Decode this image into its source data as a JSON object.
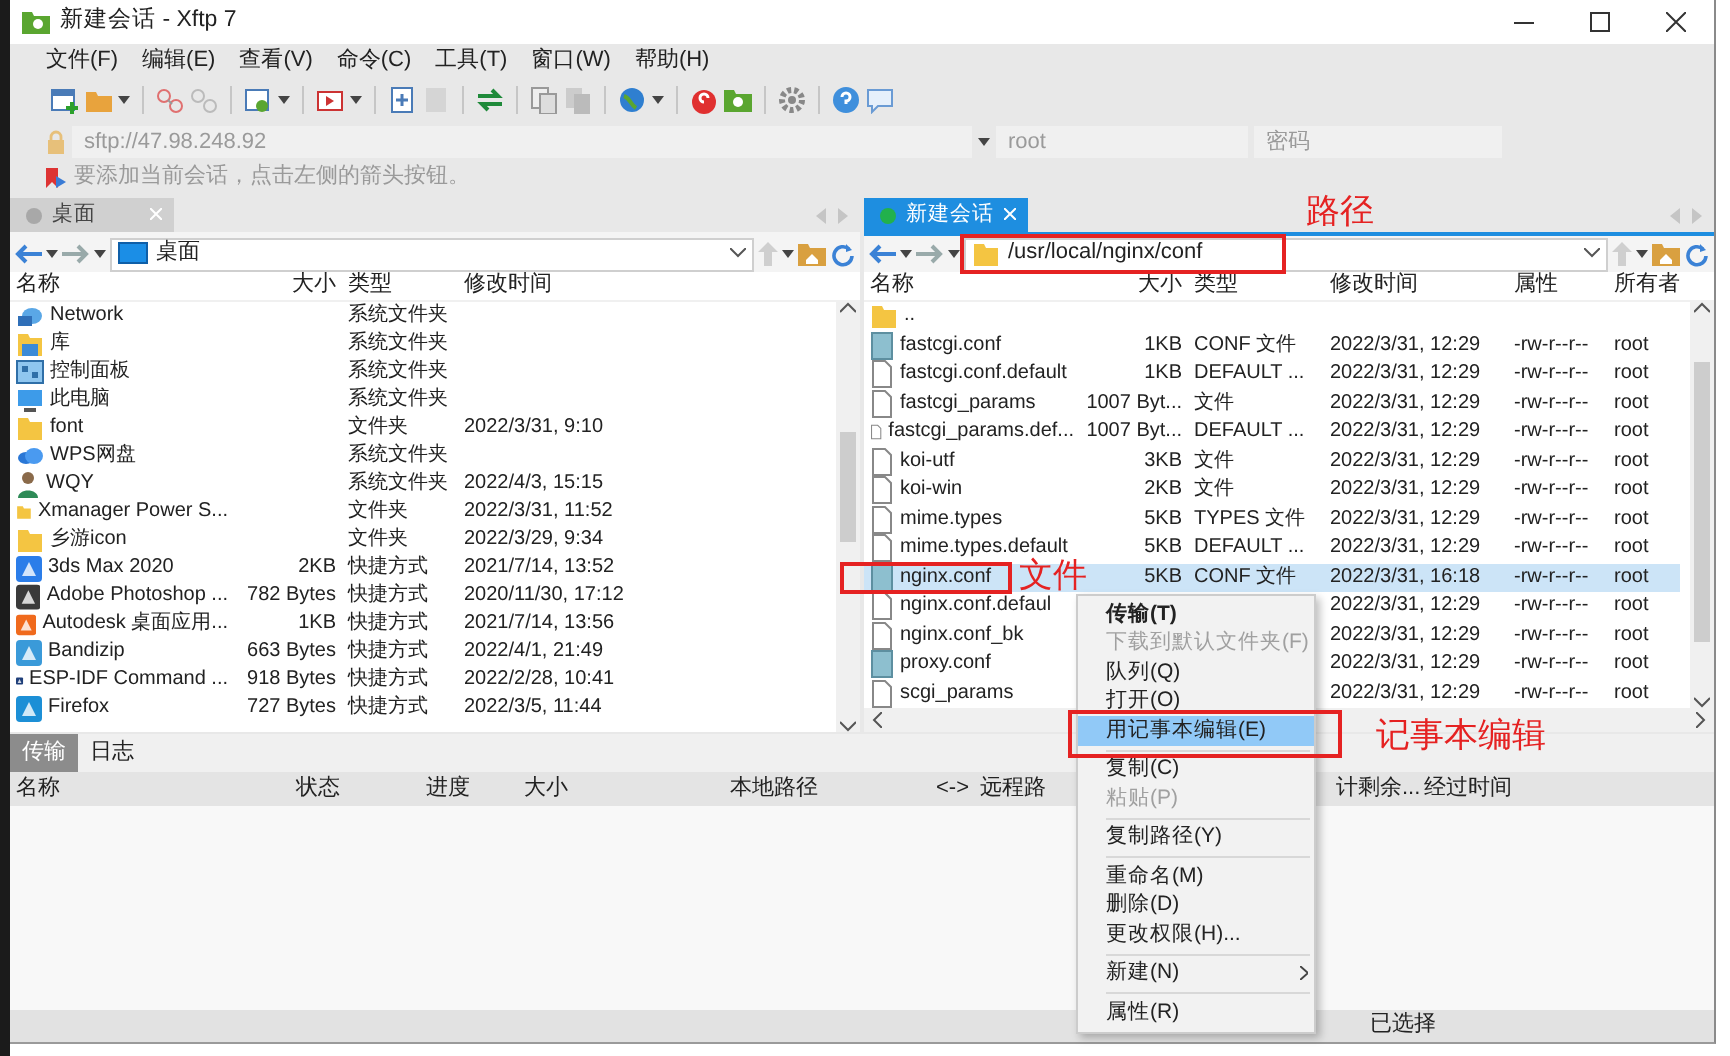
{
  "window": {
    "title": "新建会话 - Xftp 7"
  },
  "menu": [
    "文件(F)",
    "编辑(E)",
    "查看(V)",
    "命令(C)",
    "工具(T)",
    "窗口(W)",
    "帮助(H)"
  ],
  "address": {
    "host": "sftp://47.98.248.92",
    "user": "root",
    "password_placeholder": "密码"
  },
  "hint": "要添加当前会话，点击左侧的箭头按钮。",
  "panes": [
    {
      "tab": {
        "label": "桌面",
        "selected": false,
        "color": "#a8a8a8"
      },
      "path": "桌面",
      "columns": [
        "名称",
        "大小",
        "类型",
        "修改时间"
      ],
      "rows": [
        {
          "name": "Network",
          "type": "系统文件夹",
          "kind": "network",
          "selected": false
        },
        {
          "name": "库",
          "type": "系统文件夹",
          "kind": "library",
          "selected": false
        },
        {
          "name": "控制面板",
          "type": "系统文件夹",
          "kind": "panel",
          "selected": false
        },
        {
          "name": "此电脑",
          "type": "系统文件夹",
          "kind": "computer",
          "selected": false
        },
        {
          "name": "font",
          "type": "文件夹",
          "date": "2022/3/31, 9:10",
          "kind": "folder",
          "selected": false
        },
        {
          "name": "WPS网盘",
          "type": "系统文件夹",
          "kind": "cloud",
          "selected": false
        },
        {
          "name": "WQY",
          "type": "系统文件夹",
          "date": "2022/4/3, 15:15",
          "kind": "user",
          "selected": false
        },
        {
          "name": "Xmanager Power S...",
          "type": "文件夹",
          "date": "2022/3/31, 11:52",
          "kind": "folder",
          "selected": false
        },
        {
          "name": "乡游icon",
          "type": "文件夹",
          "date": "2022/3/29, 9:34",
          "kind": "folder",
          "selected": false
        },
        {
          "name": "3ds Max 2020",
          "size": "2KB",
          "type": "快捷方式",
          "date": "2021/7/14, 13:52",
          "kind": "app",
          "selected": false
        },
        {
          "name": "Adobe Photoshop ...",
          "size": "782 Bytes",
          "type": "快捷方式",
          "date": "2020/11/30, 17:12",
          "kind": "app",
          "selected": false
        },
        {
          "name": "Autodesk 桌面应用...",
          "size": "1KB",
          "type": "快捷方式",
          "date": "2021/7/14, 13:56",
          "kind": "app",
          "selected": false
        },
        {
          "name": "Bandizip",
          "size": "663 Bytes",
          "type": "快捷方式",
          "date": "2022/4/1, 21:49",
          "kind": "app",
          "selected": false
        },
        {
          "name": "ESP-IDF Command ...",
          "size": "918 Bytes",
          "type": "快捷方式",
          "date": "2022/2/28, 10:41",
          "kind": "app",
          "selected": false
        },
        {
          "name": "Firefox",
          "size": "727 Bytes",
          "type": "快捷方式",
          "date": "2022/3/5, 11:44",
          "kind": "app",
          "selected": false
        }
      ]
    },
    {
      "tab": {
        "label": "新建会话",
        "selected": true,
        "color": "#22b14c"
      },
      "path": "/usr/local/nginx/conf",
      "columns": [
        "名称",
        "大小",
        "类型",
        "修改时间",
        "属性",
        "所有者"
      ],
      "rows": [
        {
          "name": "..",
          "kind": "folder",
          "selected": false
        },
        {
          "name": "fastcgi.conf",
          "size": "1KB",
          "type": "CONF 文件",
          "date": "2022/3/31, 12:29",
          "perm": "-rw-r--r--",
          "owner": "root",
          "kind": "conf",
          "selected": false
        },
        {
          "name": "fastcgi.conf.default",
          "size": "1KB",
          "type": "DEFAULT ...",
          "date": "2022/3/31, 12:29",
          "perm": "-rw-r--r--",
          "owner": "root",
          "kind": "file",
          "selected": false
        },
        {
          "name": "fastcgi_params",
          "size": "1007 Byt...",
          "type": "文件",
          "date": "2022/3/31, 12:29",
          "perm": "-rw-r--r--",
          "owner": "root",
          "kind": "file",
          "selected": false
        },
        {
          "name": "fastcgi_params.def...",
          "size": "1007 Byt...",
          "type": "DEFAULT ...",
          "date": "2022/3/31, 12:29",
          "perm": "-rw-r--r--",
          "owner": "root",
          "kind": "file",
          "selected": false
        },
        {
          "name": "koi-utf",
          "size": "3KB",
          "type": "文件",
          "date": "2022/3/31, 12:29",
          "perm": "-rw-r--r--",
          "owner": "root",
          "kind": "file",
          "selected": false
        },
        {
          "name": "koi-win",
          "size": "2KB",
          "type": "文件",
          "date": "2022/3/31, 12:29",
          "perm": "-rw-r--r--",
          "owner": "root",
          "kind": "file",
          "selected": false
        },
        {
          "name": "mime.types",
          "size": "5KB",
          "type": "TYPES 文件",
          "date": "2022/3/31, 12:29",
          "perm": "-rw-r--r--",
          "owner": "root",
          "kind": "file",
          "selected": false
        },
        {
          "name": "mime.types.default",
          "size": "5KB",
          "type": "DEFAULT ...",
          "date": "2022/3/31, 12:29",
          "perm": "-rw-r--r--",
          "owner": "root",
          "kind": "file",
          "selected": false
        },
        {
          "name": "nginx.conf",
          "size": "5KB",
          "type": "CONF 文件",
          "date": "2022/3/31, 16:18",
          "perm": "-rw-r--r--",
          "owner": "root",
          "kind": "conf",
          "selected": true
        },
        {
          "name": "nginx.conf.defaul",
          "date": "2022/3/31, 12:29",
          "perm": "-rw-r--r--",
          "owner": "root",
          "kind": "file",
          "selected": false
        },
        {
          "name": "nginx.conf_bk",
          "date": "2022/3/31, 12:29",
          "perm": "-rw-r--r--",
          "owner": "root",
          "kind": "file",
          "selected": false
        },
        {
          "name": "proxy.conf",
          "date": "2022/3/31, 12:29",
          "perm": "-rw-r--r--",
          "owner": "root",
          "kind": "conf",
          "selected": false
        },
        {
          "name": "scgi_params",
          "date": "2022/3/31, 12:29",
          "perm": "-rw-r--r--",
          "owner": "root",
          "kind": "file",
          "selected": false
        }
      ]
    }
  ],
  "context_menu": [
    {
      "kind": "item",
      "label": "传输(T)",
      "default": true,
      "disabled": false,
      "selected": false
    },
    {
      "kind": "item",
      "label": "下载到默认文件夹(F)",
      "default": false,
      "disabled": true,
      "selected": false
    },
    {
      "kind": "item",
      "label": "队列(Q)",
      "default": false,
      "disabled": false,
      "selected": false
    },
    {
      "kind": "item",
      "label": "打开(O)",
      "default": false,
      "disabled": false,
      "selected": false
    },
    {
      "kind": "item",
      "label": "用记事本编辑(E)",
      "default": false,
      "disabled": false,
      "selected": true
    },
    {
      "kind": "separator"
    },
    {
      "kind": "item",
      "label": "复制(C)",
      "default": false,
      "disabled": false,
      "selected": false
    },
    {
      "kind": "item",
      "label": "粘贴(P)",
      "default": false,
      "disabled": true,
      "selected": false
    },
    {
      "kind": "separator"
    },
    {
      "kind": "item",
      "label": "复制路径(Y)",
      "default": false,
      "disabled": false,
      "selected": false
    },
    {
      "kind": "separator"
    },
    {
      "kind": "item",
      "label": "重命名(M)",
      "default": false,
      "disabled": false,
      "selected": false
    },
    {
      "kind": "item",
      "label": "删除(D)",
      "default": false,
      "disabled": false,
      "selected": false
    },
    {
      "kind": "item",
      "label": "更改权限(H)...",
      "default": false,
      "disabled": false,
      "selected": false
    },
    {
      "kind": "separator"
    },
    {
      "kind": "item",
      "label": "新建(N)",
      "default": false,
      "disabled": false,
      "selected": false,
      "submenu": true
    },
    {
      "kind": "separator"
    },
    {
      "kind": "item",
      "label": "属性(R)",
      "default": false,
      "disabled": false,
      "selected": false
    }
  ],
  "annotations": [
    {
      "kind": "path",
      "label": "路径"
    },
    {
      "kind": "file",
      "label": "文件"
    },
    {
      "kind": "menu",
      "label": "记事本编辑"
    }
  ],
  "transfer": {
    "tabs": [
      {
        "label": "传输",
        "selected": true
      },
      {
        "label": "日志",
        "selected": false
      }
    ],
    "columns": [
      "名称",
      "状态",
      "进度",
      "大小",
      "本地路径",
      "<->",
      "远程路",
      "计剩余...",
      "经过时间"
    ]
  },
  "status_bar": [
    "已选择"
  ]
}
